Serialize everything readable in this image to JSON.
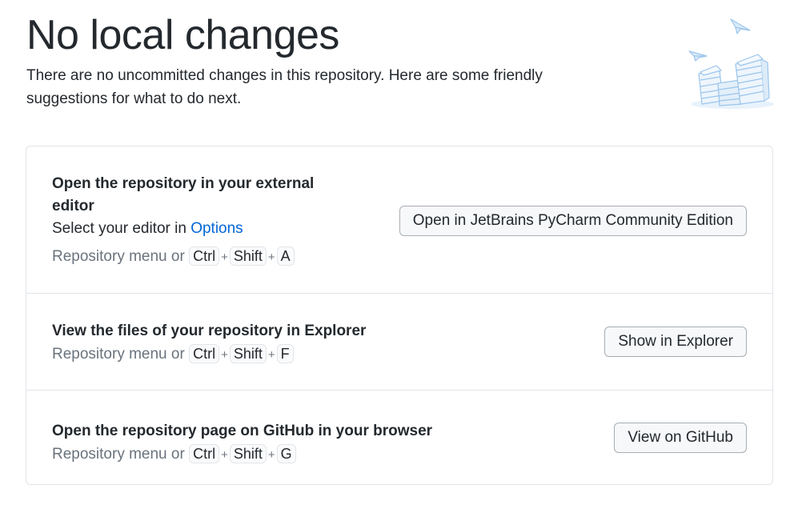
{
  "header": {
    "title": "No local changes",
    "subtitle": "There are no uncommitted changes in this repository. Here are some friendly suggestions for what to do next."
  },
  "illustration": {
    "icon": "paper-stacks-illustration",
    "color": "#9ac5ec"
  },
  "suggestions": [
    {
      "title": "Open the repository in your external editor",
      "description_prefix": "Select your editor in ",
      "description_link": "Options",
      "shortcut_prefix": "Repository menu or",
      "keys": [
        "Ctrl",
        "Shift",
        "A"
      ],
      "button_label": "Open in JetBrains PyCharm Community Edition"
    },
    {
      "title": "View the files of your repository in Explorer",
      "shortcut_prefix": "Repository menu or",
      "keys": [
        "Ctrl",
        "Shift",
        "F"
      ],
      "button_label": "Show in Explorer"
    },
    {
      "title": "Open the repository page on GitHub in your browser",
      "shortcut_prefix": "Repository menu or",
      "keys": [
        "Ctrl",
        "Shift",
        "G"
      ],
      "button_label": "View on GitHub"
    }
  ],
  "key_separator": "+",
  "colors": {
    "text": "#24292e",
    "muted": "#6a737d",
    "link": "#0366d6",
    "border": "#e1e4e8",
    "button_bg": "#f6f8fa"
  }
}
